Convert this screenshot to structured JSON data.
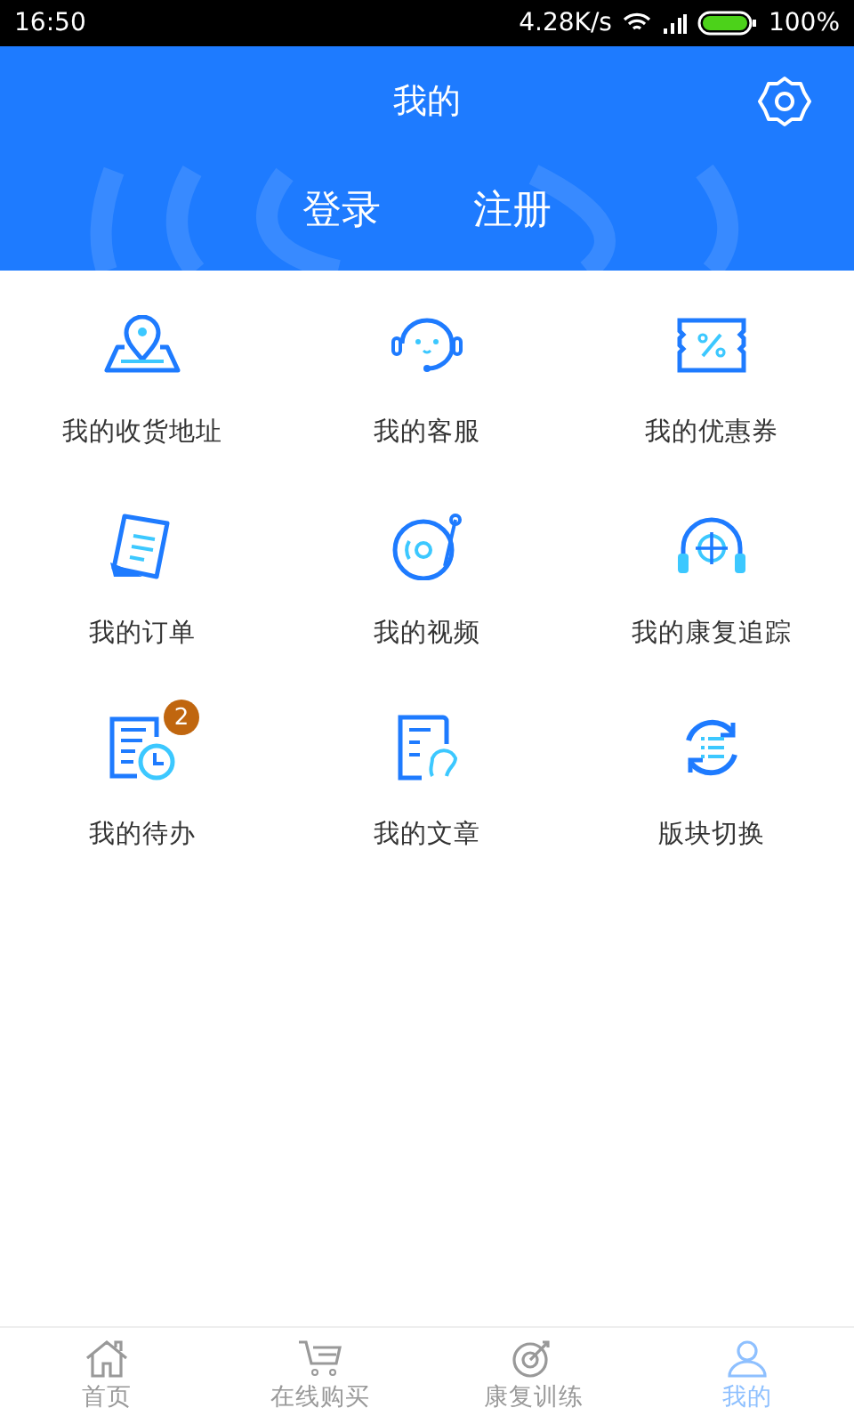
{
  "status_bar": {
    "time": "16:50",
    "speed": "4.28K/s",
    "battery": "100%"
  },
  "header": {
    "title": "我的",
    "login": "登录",
    "register": "注册"
  },
  "menu": [
    {
      "kind": "address",
      "label": "我的收货地址"
    },
    {
      "kind": "service",
      "label": "我的客服"
    },
    {
      "kind": "coupon",
      "label": "我的优惠券"
    },
    {
      "kind": "order",
      "label": "我的订单"
    },
    {
      "kind": "video",
      "label": "我的视频"
    },
    {
      "kind": "tracking",
      "label": "我的康复追踪"
    },
    {
      "kind": "todo",
      "label": "我的待办",
      "badge": "2"
    },
    {
      "kind": "article",
      "label": "我的文章"
    },
    {
      "kind": "switch",
      "label": "版块切换"
    }
  ],
  "tab_bar": [
    {
      "kind": "home",
      "label": "首页",
      "selected": false
    },
    {
      "kind": "cart",
      "label": "在线购买",
      "selected": false
    },
    {
      "kind": "target",
      "label": "康复训练",
      "selected": false
    },
    {
      "kind": "person",
      "label": "我的",
      "selected": true
    }
  ]
}
